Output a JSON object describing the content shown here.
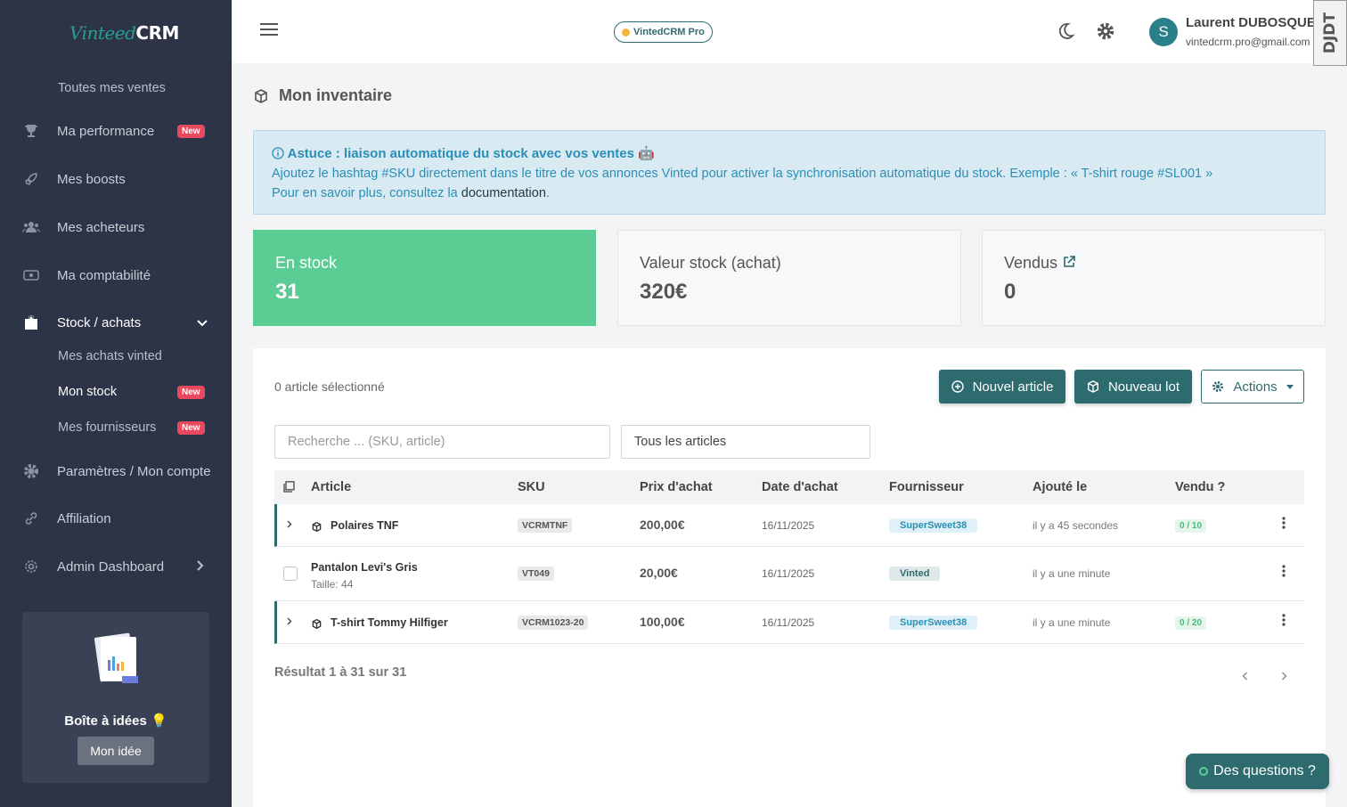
{
  "app": {
    "logo_part1": "Vinteed",
    "logo_part2": "CRM",
    "pro_badge": "VintedCRM Pro"
  },
  "sidebar": {
    "items": [
      {
        "label": "Toutes mes ventes"
      },
      {
        "label": "Ma performance",
        "badge": "New",
        "icon": "trophy-icon"
      },
      {
        "label": "Mes boosts",
        "icon": "rocket-icon"
      },
      {
        "label": "Mes acheteurs",
        "icon": "users-icon"
      },
      {
        "label": "Ma comptabilité",
        "icon": "money-icon"
      },
      {
        "label": "Stock / achats",
        "icon": "bag-icon"
      },
      {
        "label": "Mes achats vinted"
      },
      {
        "label": "Mon stock",
        "badge": "New"
      },
      {
        "label": "Mes fournisseurs",
        "badge": "New"
      },
      {
        "label": "Paramètres / Mon compte",
        "icon": "gear-icon"
      },
      {
        "label": "Affiliation",
        "icon": "link-icon"
      },
      {
        "label": "Admin Dashboard",
        "icon": "cog-icon"
      }
    ],
    "idea_box": {
      "title": "Boîte à idées 💡",
      "button": "Mon idée"
    }
  },
  "user": {
    "initial": "S",
    "name": "Laurent DUBOSQUET",
    "email": "vintedcrm.pro@gmail.com"
  },
  "extension_tab": "DJDT",
  "page": {
    "title": "Mon inventaire"
  },
  "alert": {
    "title": "Astuce : liaison automatique du stock avec vos ventes 🤖",
    "line1": "Ajoutez le hashtag #SKU directement dans le titre de vos annonces Vinted pour activer la synchronisation automatique du stock. Exemple : « T-shirt rouge #SL001 »",
    "line2_prefix": "Pour en savoir plus, consultez la ",
    "link": "documentation",
    "line2_suffix": "."
  },
  "stats": [
    {
      "label": "En stock",
      "value": "31"
    },
    {
      "label": "Valeur stock (achat)",
      "value": "320€"
    },
    {
      "label": "Vendus",
      "value": "0"
    }
  ],
  "toolbar": {
    "selected": "0 article sélectionné",
    "new_article": "Nouvel article",
    "new_lot": "Nouveau lot",
    "actions": "Actions",
    "search_placeholder": "Recherche ... (SKU, article)",
    "filter_value": "Tous les articles"
  },
  "table": {
    "headers": [
      "Article",
      "SKU",
      "Prix d'achat",
      "Date d'achat",
      "Fournisseur",
      "Ajouté le",
      "Vendu ?"
    ],
    "rows": [
      {
        "article": "Polaires TNF",
        "sub": "",
        "sku": "VCRMTNF",
        "price": "200,00€",
        "date": "16/11/2025",
        "supplier": "SuperSweet38",
        "added": "il y a 45 secondes",
        "sold": "0 / 10"
      },
      {
        "article": "Pantalon Levi's Gris",
        "sub": "Taille: 44",
        "sku": "VT049",
        "price": "20,00€",
        "date": "16/11/2025",
        "supplier": "Vinted",
        "added": "il y a une minute",
        "sold": ""
      },
      {
        "article": "T-shirt Tommy Hilfiger",
        "sub": "",
        "sku": "VCRM1023-20",
        "price": "100,00€",
        "date": "16/11/2025",
        "supplier": "SuperSweet38",
        "added": "il y a une minute",
        "sold": "0 / 20"
      }
    ]
  },
  "pagination": {
    "result": "Résultat 1 à 31 sur 31"
  },
  "help": {
    "label": "Des questions ?"
  },
  "colors": {
    "sidebar": "#2e3447",
    "accent": "#2e6b6e",
    "green": "#5ccc95",
    "badge": "#e8495f"
  }
}
